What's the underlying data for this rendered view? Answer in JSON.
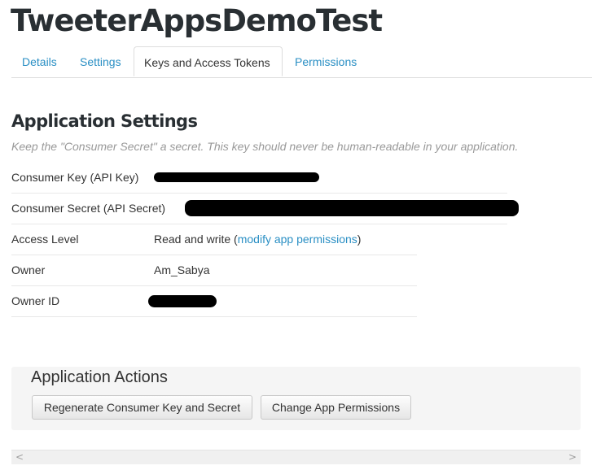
{
  "app": {
    "title": "TweeterAppsDemoTest"
  },
  "tabs": [
    {
      "label": "Details"
    },
    {
      "label": "Settings"
    },
    {
      "label": "Keys and Access Tokens"
    },
    {
      "label": "Permissions"
    }
  ],
  "active_tab": "Keys and Access Tokens",
  "settings": {
    "title": "Application Settings",
    "note": "Keep the \"Consumer Secret\" a secret. This key should never be human-readable in your application.",
    "rows": [
      {
        "label": "Consumer Key (API Key)",
        "value": "",
        "redacted": true
      },
      {
        "label": "Consumer Secret (API Secret)",
        "value": "",
        "redacted": true
      },
      {
        "label": "Access Level",
        "value_prefix": "Read and write (",
        "link": "modify app permissions",
        "value_suffix": ")"
      },
      {
        "label": "Owner",
        "value": "Am_Sabya"
      },
      {
        "label": "Owner ID",
        "value": "",
        "redacted": true
      }
    ]
  },
  "actions": {
    "title": "Application Actions",
    "regenerate_label": "Regenerate Consumer Key and Secret",
    "change_permissions_label": "Change App Permissions"
  },
  "scrollbar": {
    "left_arrow": "<",
    "right_arrow": ">"
  },
  "colors": {
    "link": "#2a8fc4",
    "title": "#292f33",
    "note": "#999999",
    "redaction": "#000000"
  }
}
